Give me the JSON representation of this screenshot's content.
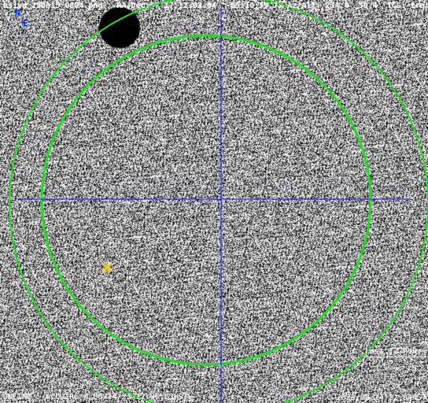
{
  "header": {
    "filename": "asiva_230815_0804.png",
    "radec_label": "RA,Dec:",
    "ra": "17:12:03.64",
    "dec": "-05:10:59.7",
    "azalt_label": "Az/Alt:",
    "az": "234.0",
    "alt": "50.4",
    "tcs_label": "TCS:",
    "tcs_state": "track"
  },
  "compass": {
    "north": "N",
    "east": "E"
  },
  "legend": {
    "period": "Last 12 Hours"
  },
  "footer": {
    "status": "ONLINE : ACQUIRE @ 08/14/23 22:06:03HST",
    "timestamp": "2023/08/14 22:04HST"
  },
  "colors": {
    "circle": "#22dd22",
    "crosshair": "#1a1aff",
    "target_marker": "#ffd400",
    "compass_text": "#0033ff"
  },
  "icons": {
    "target": "x-marker-icon"
  }
}
